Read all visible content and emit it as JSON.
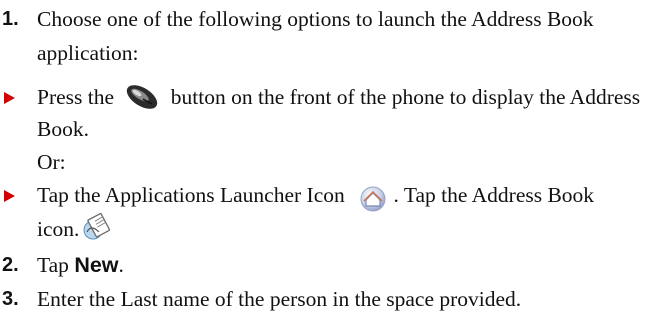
{
  "steps": [
    {
      "number": "1.",
      "line1": "Choose one of the following options to launch the Address Book",
      "line2": "application:"
    },
    {
      "number": "2.",
      "prefix": "Tap ",
      "bold": "New",
      "suffix": "."
    },
    {
      "number": "3.",
      "text": "Enter the Last name of the person in the space provided."
    }
  ],
  "options": [
    {
      "before_icon": "Press the",
      "after_icon": "button on the front of the phone to display the Address",
      "line2": "Book.",
      "icon": "address-book-hardware-button-icon"
    },
    {
      "before_icon": "Tap the Applications Launcher Icon",
      "after_icon": ". Tap the Address Book",
      "line2": "icon.",
      "icon_launcher": "applications-launcher-icon",
      "icon_address_book": "address-book-icon"
    }
  ],
  "or_label": "Or:",
  "colors": {
    "bullet": "#d40000",
    "text": "#111111"
  }
}
